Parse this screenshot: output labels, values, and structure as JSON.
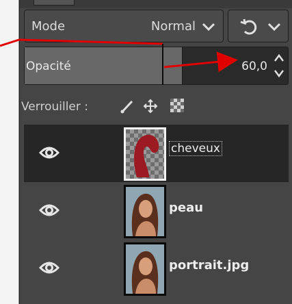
{
  "mode": {
    "label": "Mode",
    "value": "Normal"
  },
  "opacity": {
    "label": "Opacité",
    "value": "60,0",
    "fraction": 0.6
  },
  "lock": {
    "label": "Verrouiller :",
    "icons": [
      "brush-icon",
      "move-icon",
      "checkerboard-icon"
    ]
  },
  "layers": [
    {
      "name": "cheveux",
      "selected": true,
      "visible": true,
      "thumb": "hair-mask-on-checker"
    },
    {
      "name": "peau",
      "selected": false,
      "visible": true,
      "thumb": "portrait"
    },
    {
      "name": "portrait.jpg",
      "selected": false,
      "visible": true,
      "thumb": "portrait"
    }
  ],
  "colors": {
    "panel": "#454545",
    "selected_row": "#262626",
    "annotation": "#e00000"
  }
}
